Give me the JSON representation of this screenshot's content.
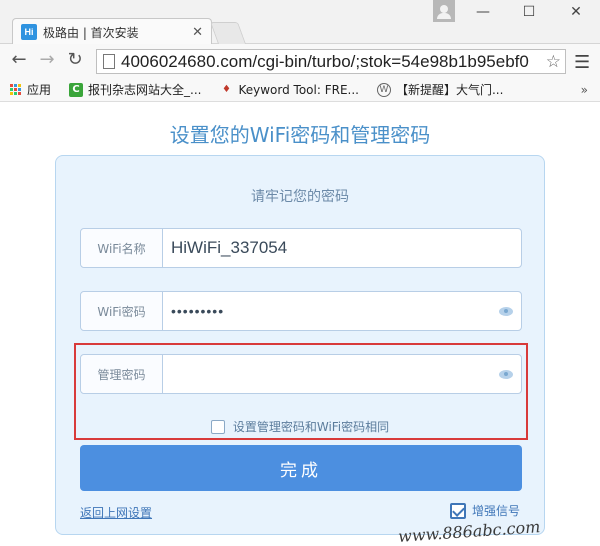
{
  "browser": {
    "tab": {
      "favicon": "Hi",
      "title": "极路由 | 首次安装",
      "close_glyph": "✕"
    },
    "window": {
      "minimize": "—",
      "maximize": "☐",
      "close": "✕"
    },
    "nav": {
      "back": "←",
      "forward": "→",
      "reload": "↻",
      "menu": "☰",
      "star": "☆"
    },
    "url": "4006024680.com/cgi-bin/turbo/;stok=54e98b1b95ebf0",
    "bookmarks": [
      {
        "label": "应用",
        "icon": "apps-grid-icon"
      },
      {
        "label": "报刊杂志网站大全_...",
        "icon": "green-c-icon"
      },
      {
        "label": "Keyword Tool: FRE...",
        "icon": "flame-icon"
      },
      {
        "label": "【新提醒】大气门...",
        "icon": "wordpress-icon"
      }
    ],
    "bookmarks_more": "»"
  },
  "page": {
    "title": "设置您的WiFi密码和管理密码",
    "subtitle": "请牢记您的密码",
    "fields": [
      {
        "label": "WiFi名称",
        "value": "HiWiFi_337054"
      },
      {
        "label": "WiFi密码",
        "value": "•••••••••"
      },
      {
        "label": "管理密码",
        "value": ""
      }
    ],
    "same_password_checkbox": "设置管理密码和WiFi密码相同",
    "submit": "完成",
    "back_link": "返回上网设置",
    "boost_signal": "增强信号"
  },
  "watermark": "www.886abc.com",
  "colors": {
    "accent": "#4c8fe0",
    "highlight": "#d83a3a",
    "card_bg": "#e8f3fd"
  }
}
